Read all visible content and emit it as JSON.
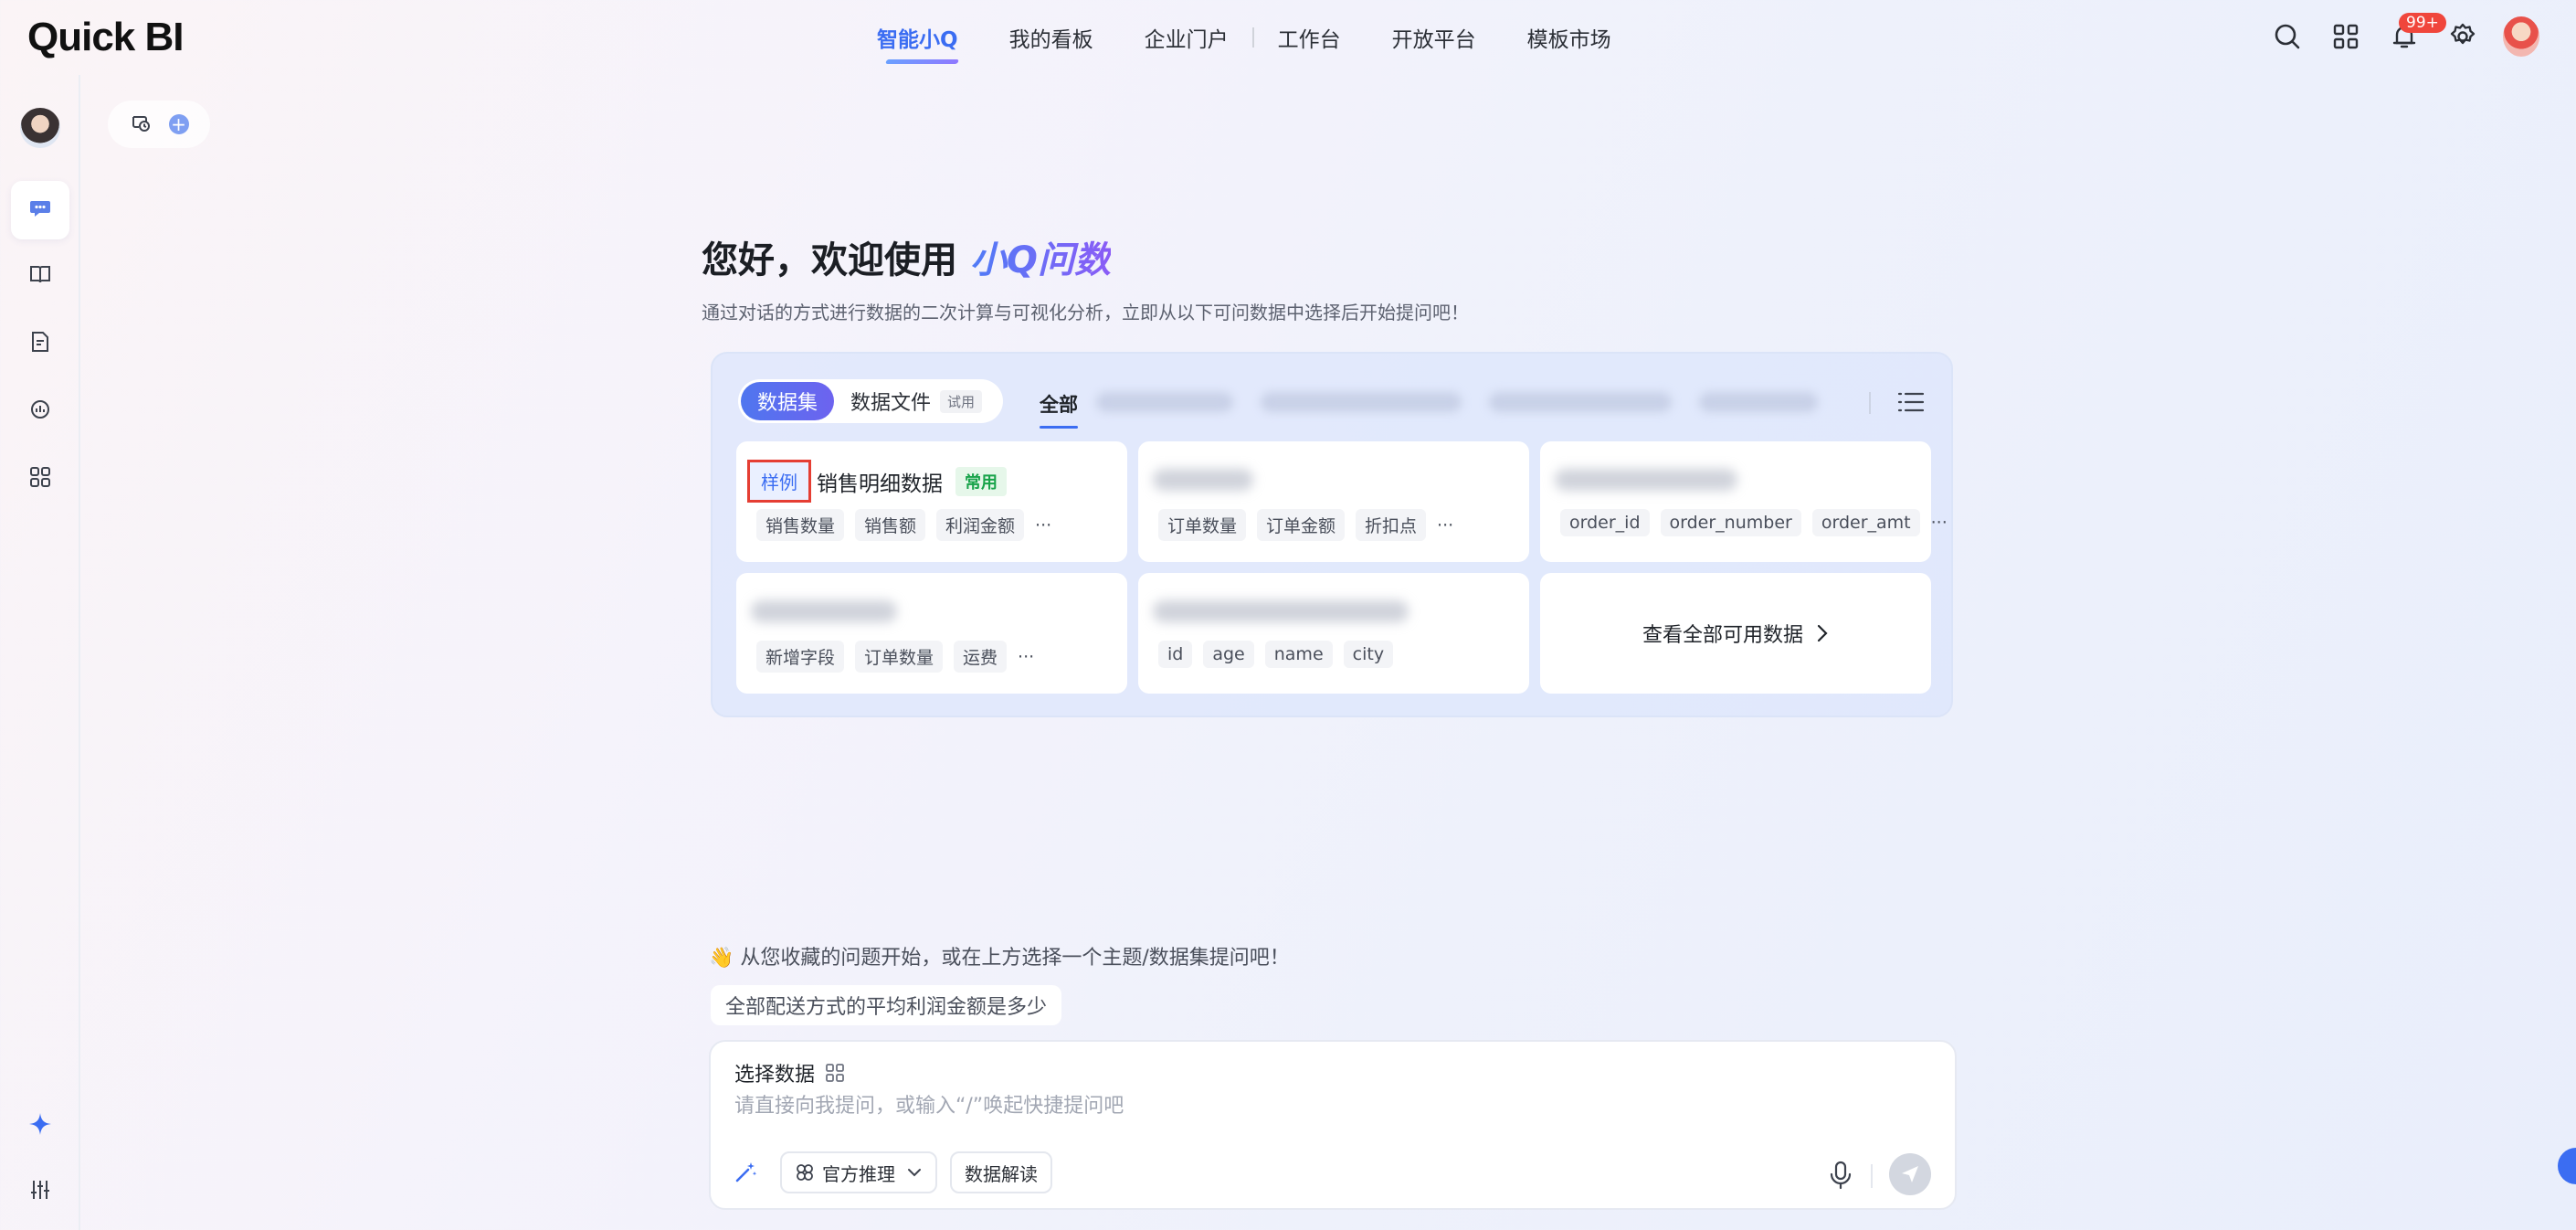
{
  "header": {
    "logo": "Quick BI",
    "nav": [
      {
        "label": "智能小Q",
        "active": true
      },
      {
        "label": "我的看板",
        "active": false
      },
      {
        "label": "企业门户",
        "active": false
      },
      {
        "label": "工作台",
        "active": false
      },
      {
        "label": "开放平台",
        "active": false
      },
      {
        "label": "模板市场",
        "active": false
      }
    ],
    "icons": [
      "search-icon",
      "apps-grid-icon",
      "bell-icon",
      "gear-icon",
      "user-avatar"
    ],
    "notification_badge": "99+"
  },
  "sidebar": {
    "items": [
      "chat-icon",
      "book-icon",
      "report-icon",
      "analysis-icon",
      "modules-icon",
      "sparkle-icon",
      "sliders-icon"
    ]
  },
  "welcome": {
    "title_prefix": "您好，欢迎使用 ",
    "title_brand": "小Q问数",
    "subtitle": "通过对话的方式进行数据的二次计算与可视化分析，立即从以下可问数据中选择后开始提问吧！"
  },
  "panel": {
    "seg_dataset": "数据集",
    "seg_file": "数据文件",
    "seg_file_tag": "试用",
    "tab_all": "全部",
    "cards": [
      {
        "tag": "样例",
        "title": "销售明细数据",
        "badge": "常用",
        "fields": [
          "销售数量",
          "销售额",
          "利润金额"
        ],
        "more": "···"
      },
      {
        "fields": [
          "订单数量",
          "订单金额",
          "折扣点"
        ],
        "more": "···"
      },
      {
        "fields": [
          "order_id",
          "order_number",
          "order_amt"
        ],
        "more": "···"
      },
      {
        "fields": [
          "新增字段",
          "订单数量",
          "运费"
        ],
        "more": "···"
      },
      {
        "fields": [
          "id",
          "age",
          "name",
          "city"
        ]
      }
    ],
    "view_all": "查看全部可用数据"
  },
  "suggestions": {
    "hint": "👋 从您收藏的问题开始，或在上方选择一个主题/数据集提问吧！",
    "chip": "全部配送方式的平均利润金额是多少"
  },
  "input": {
    "select_data": "选择数据",
    "placeholder": "请直接向我提问，或输入“/”唤起快捷提问吧",
    "value": "",
    "recommend": "官方推理",
    "interpret": "数据解读"
  },
  "colors": {
    "accent": "#3b6df2",
    "sample_border": "#e53e33",
    "common_green": "#18a34a"
  }
}
